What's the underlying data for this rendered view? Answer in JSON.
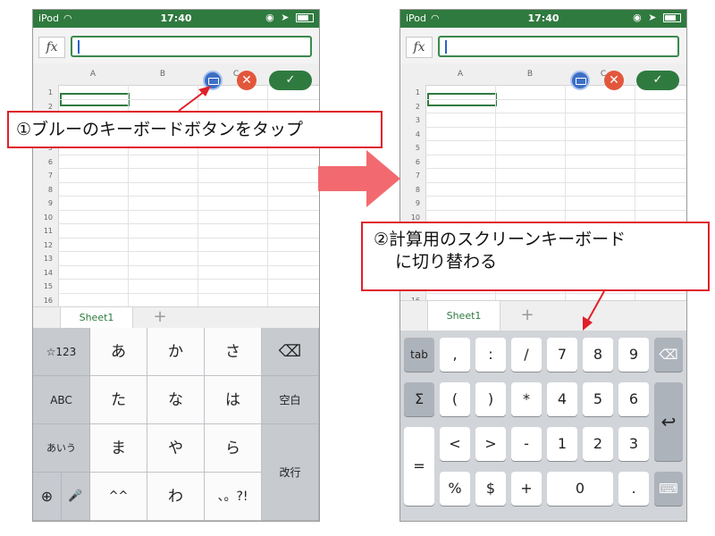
{
  "status_bar": {
    "carrier": "iPod",
    "time": "17:40"
  },
  "formula_bar": {
    "fx_label": "fx",
    "value": ""
  },
  "columns": [
    "A",
    "B",
    "C"
  ],
  "rows": [
    "1",
    "2",
    "3",
    "4",
    "5",
    "6",
    "7",
    "8",
    "9",
    "10",
    "11",
    "12",
    "13",
    "14",
    "15",
    "16"
  ],
  "sheet_bar": {
    "sheet_tab": "Sheet1",
    "add_sheet": "+"
  },
  "cell_edit": {
    "cancel_glyph": "✕",
    "confirm_glyph": "✓"
  },
  "callouts": {
    "step1": "①ブルーのキーボードボタンをタップ",
    "step2_line1": "②計算用のスクリーンキーボード",
    "step2_line2": "に切り替わる"
  },
  "kana_keyboard": {
    "side_left": [
      "☆123",
      "ABC",
      "あいう"
    ],
    "keys": [
      [
        "あ",
        "か",
        "さ"
      ],
      [
        "た",
        "な",
        "は"
      ],
      [
        "ま",
        "や",
        "ら"
      ],
      [
        "^^",
        "わ",
        "、。?!"
      ]
    ],
    "side_right": [
      "⌫",
      "空白",
      "改行"
    ],
    "globe": "⊕",
    "mic": "🎤",
    "colors": {
      "key": "#fbfbfb",
      "side": "#c7cacf",
      "background": "#d1d4d8"
    }
  },
  "numeric_keyboard": {
    "rows": [
      [
        "tab",
        ",",
        ":",
        "/",
        "7",
        "8",
        "9"
      ],
      [
        "Σ",
        "(",
        ")",
        "*",
        "4",
        "5",
        "6"
      ],
      [
        "=",
        "<",
        ">",
        "-",
        "1",
        "2",
        "3"
      ],
      [
        "%",
        "$",
        "+",
        "0",
        "."
      ]
    ],
    "backspace": "⌫",
    "return": "↩",
    "keyboard_toggle": "⌨"
  },
  "colors": {
    "excel_green": "#2f7a3f",
    "callout_border": "#e0202a",
    "arrow": "#f26a6f",
    "keyboard_button": "#3d6fc4",
    "cancel_red": "#e2573b"
  }
}
